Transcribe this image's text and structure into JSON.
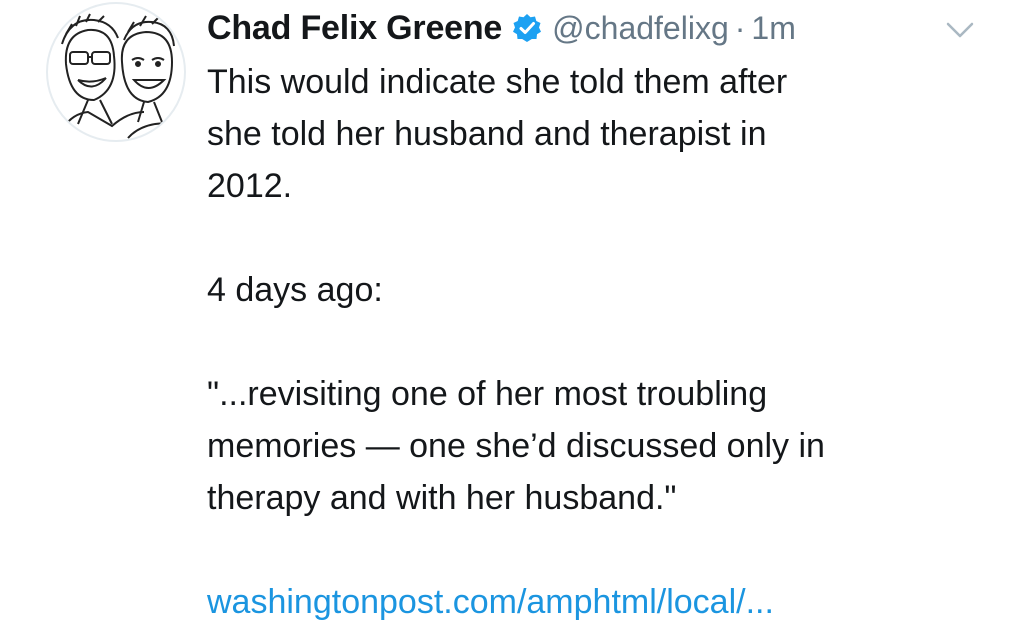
{
  "tweet": {
    "author_name": "Chad Felix Greene",
    "verified_icon": "verified-badge-icon",
    "handle": "@chadfelixg",
    "separator": "·",
    "time": "1m",
    "menu_icon": "chevron-down-icon",
    "paragraph_1_line_1": "This would indicate she told them after",
    "paragraph_1_line_2": "she told her husband and therapist in",
    "paragraph_1_line_3": "2012.",
    "paragraph_2": "4 days ago:",
    "quote_line_1": "\"...revisiting one of her most troubling",
    "quote_line_2": "memories — one she’d discussed only in",
    "quote_line_3": "therapy and with her husband.\"",
    "link_text": "washingtonpost.com/amphtml/local/..."
  },
  "colors": {
    "text": "#14171a",
    "secondary": "#657786",
    "link": "#1b95e0",
    "verified": "#1da1f2"
  }
}
